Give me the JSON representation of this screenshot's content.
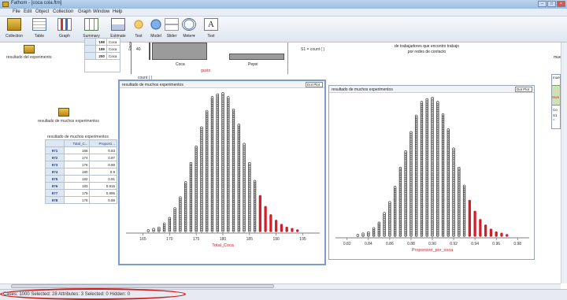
{
  "window": {
    "title": "Fathom - [coca cola.ftm]",
    "buttons": [
      "–",
      "□",
      "×"
    ]
  },
  "menu": [
    "File",
    "Edit",
    "Object",
    "Collection",
    "Graph",
    "Window",
    "Help"
  ],
  "toolbar": [
    "Collection",
    "Table",
    "Graph",
    "Summary",
    "Estimate",
    "Test",
    "Model",
    "Slider",
    "Meter▾",
    "Text"
  ],
  "top_area": {
    "collection_label": "resultado del experimento",
    "top_table_rows": [
      {
        "row": "",
        "n": "198",
        "val": "Coca"
      },
      {
        "row": "",
        "n": "199",
        "val": "Coca"
      },
      {
        "row": "",
        "n": "200",
        "val": "Coca"
      }
    ],
    "bar_chart": {
      "y_axis_label": "Frecu",
      "y_tick": "40",
      "categories": [
        "Coca",
        "Pepsi"
      ],
      "xlabel": "gusto"
    },
    "count_text": "count ( )",
    "s1_text": "S1 = count ( )",
    "text_box": "de trabajadores que encontro trabajo por redes de contacto",
    "right_cut_label": "mue",
    "right_panel_label_a": "mue",
    "right_panel_label_b": "Sum",
    "right_panel_label_c": "Co",
    "right_panel_label_d": "S1 ="
  },
  "left": {
    "collection_label": "resultado de muchos experimentos",
    "table_title": "resultado de muchos experimentos",
    "columns": [
      "",
      "Total_C...",
      "Proporci..."
    ],
    "rows": [
      {
        "id": "971",
        "total": "166",
        "prop": "0.83"
      },
      {
        "id": "972",
        "total": "174",
        "prop": "0.87"
      },
      {
        "id": "973",
        "total": "176",
        "prop": "0.88"
      },
      {
        "id": "974",
        "total": "180",
        "prop": "0.9"
      },
      {
        "id": "975",
        "total": "182",
        "prop": "0.91"
      },
      {
        "id": "976",
        "total": "183",
        "prop": "0.915"
      },
      {
        "id": "977",
        "total": "179",
        "prop": "0.895"
      },
      {
        "id": "978",
        "total": "176",
        "prop": "0.88"
      }
    ]
  },
  "graph1": {
    "title": "resultado de muchos experimentos",
    "plot_type": "Dot Plot",
    "xlabel": "Total_Coca",
    "ticks": [
      "165",
      "170",
      "175",
      "180",
      "185",
      "190",
      "195"
    ]
  },
  "graph2": {
    "title": "resultado de muchos experimentos",
    "plot_type": "Dot Plot",
    "xlabel": "Proporcion_por_coca",
    "ticks": [
      "0.82",
      "0.84",
      "0.86",
      "0.88",
      "0.90",
      "0.92",
      "0.94",
      "0.96",
      "0.98"
    ]
  },
  "status": {
    "text": "Cases: 1000   Selected: 28   Attributes: 3   Selected: 0   Hidden: 0"
  },
  "colors": {
    "accent_selected": "#d0202a",
    "dot": "#222222",
    "selection_oval": "#d21b1b"
  },
  "chart_data": [
    {
      "type": "scatter",
      "title": "resultado de muchos experimentos",
      "xlabel": "Total_Coca",
      "ylabel": "",
      "xlim": [
        163,
        197
      ],
      "x": [
        166,
        167,
        168,
        169,
        170,
        171,
        172,
        173,
        174,
        175,
        176,
        177,
        178,
        179,
        180,
        181,
        182,
        183,
        184,
        185,
        186,
        187,
        188,
        189,
        190,
        191,
        192,
        193,
        194
      ],
      "counts": [
        1,
        2,
        3,
        6,
        10,
        17,
        25,
        36,
        50,
        62,
        76,
        88,
        98,
        100,
        101,
        98,
        89,
        78,
        64,
        50,
        37,
        26,
        18,
        12,
        8,
        5,
        3,
        2,
        1
      ],
      "selected_from_x": 187
    },
    {
      "type": "scatter",
      "title": "resultado de muchos experimentos",
      "xlabel": "Proporcion_por_coca",
      "ylabel": "",
      "xlim": [
        0.815,
        0.985
      ],
      "x": [
        0.83,
        0.835,
        0.84,
        0.845,
        0.85,
        0.855,
        0.86,
        0.865,
        0.87,
        0.875,
        0.88,
        0.885,
        0.89,
        0.895,
        0.9,
        0.905,
        0.91,
        0.915,
        0.92,
        0.925,
        0.93,
        0.935,
        0.94,
        0.945,
        0.95,
        0.955,
        0.96,
        0.965,
        0.97
      ],
      "counts": [
        1,
        2,
        3,
        6,
        10,
        17,
        25,
        36,
        50,
        62,
        76,
        88,
        98,
        100,
        101,
        98,
        89,
        78,
        64,
        50,
        37,
        26,
        18,
        12,
        8,
        5,
        3,
        2,
        1
      ],
      "selected_from_x": 0.935
    }
  ]
}
